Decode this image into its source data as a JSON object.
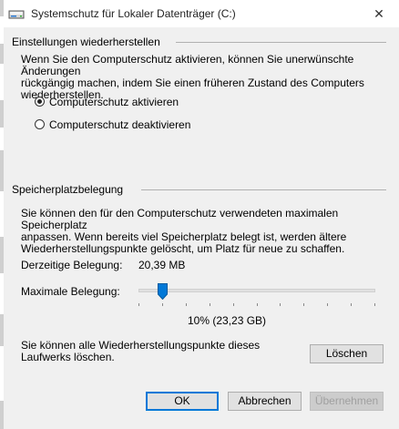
{
  "window": {
    "title": "Systemschutz für Lokaler Datenträger (C:)",
    "close_glyph": "✕",
    "icon": "drive-icon"
  },
  "restore": {
    "heading": "Einstellungen wiederherstellen",
    "description_lines": [
      "Wenn Sie den Computerschutz aktivieren, können Sie unerwünschte Änderungen",
      "rückgängig machen, indem Sie einen früheren Zustand des Computers",
      "wiederherstellen."
    ],
    "options": [
      {
        "label": "Computerschutz aktivieren",
        "selected": true
      },
      {
        "label": "Computerschutz deaktivieren",
        "selected": false
      }
    ]
  },
  "storage": {
    "heading": "Speicherplatzbelegung",
    "description_lines": [
      "Sie können den für den Computerschutz verwendeten maximalen Speicherplatz",
      "anpassen. Wenn bereits viel Speicherplatz belegt ist, werden ältere",
      "Wiederherstellungspunkte gelöscht, um Platz für neue zu schaffen."
    ],
    "current_label": "Derzeitige Belegung:",
    "current_value": "20,39 MB",
    "max_label": "Maximale Belegung:",
    "max_percent": 10,
    "max_value_text": "10% (23,23 GB)",
    "delete_text_lines": [
      "Sie können alle Wiederherstellungspunkte dieses",
      "Laufwerks löschen."
    ],
    "delete_button": "Löschen"
  },
  "footer": {
    "ok": "OK",
    "cancel": "Abbrechen",
    "apply": "Übernehmen"
  },
  "colors": {
    "accent": "#0078d7",
    "dialog_bg": "#f0f0f0"
  }
}
